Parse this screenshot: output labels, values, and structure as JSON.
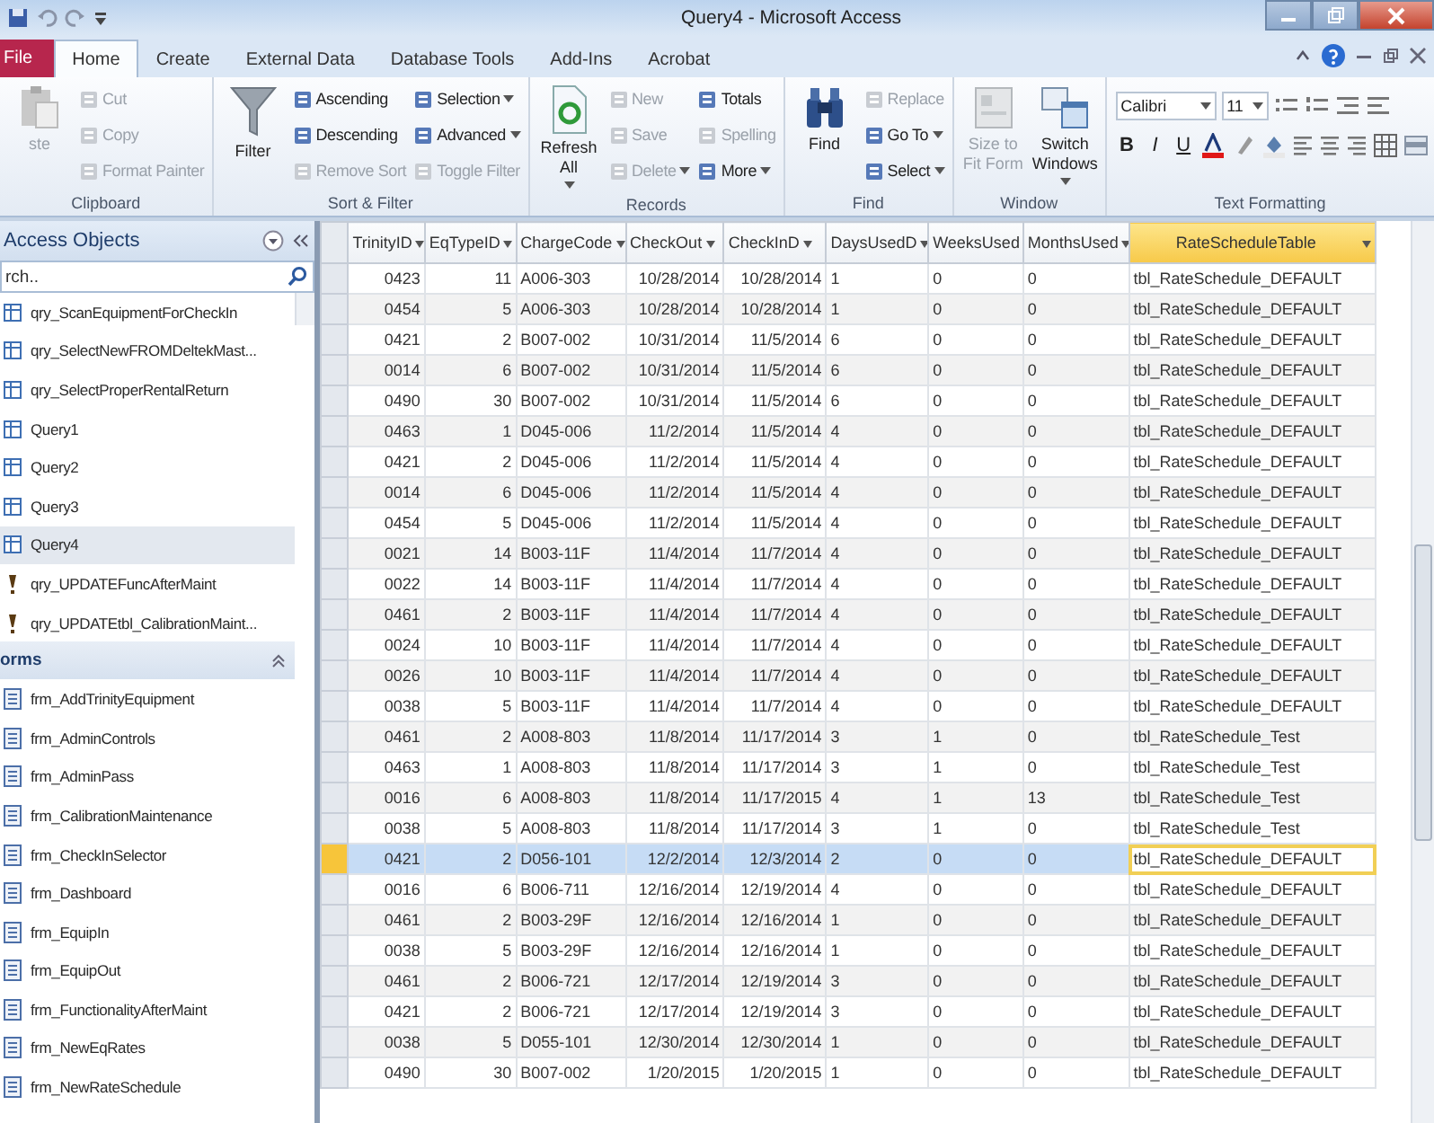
{
  "window": {
    "title": "Query4 - Microsoft Access"
  },
  "ribbon_tabs": [
    {
      "label": "File",
      "kind": "file",
      "selected": false
    },
    {
      "label": "Home",
      "kind": "tab",
      "selected": true
    },
    {
      "label": "Create",
      "kind": "tab",
      "selected": false
    },
    {
      "label": "External Data",
      "kind": "tab",
      "selected": false
    },
    {
      "label": "Database Tools",
      "kind": "tab",
      "selected": false
    },
    {
      "label": "Add-Ins",
      "kind": "tab",
      "selected": false
    },
    {
      "label": "Acrobat",
      "kind": "tab",
      "selected": false
    }
  ],
  "ribbon_groups": [
    {
      "label": "Clipboard",
      "large": [
        {
          "label": "ste",
          "disabled": true,
          "menu": false
        }
      ],
      "columns": [
        [
          {
            "label": "Cut",
            "disabled": true,
            "menu": false
          },
          {
            "label": "Copy",
            "disabled": true,
            "menu": false
          },
          {
            "label": "Format Painter",
            "disabled": true,
            "menu": false
          }
        ]
      ]
    },
    {
      "label": "Sort & Filter",
      "large": [
        {
          "label": "Filter",
          "disabled": false,
          "menu": false
        }
      ],
      "columns": [
        [
          {
            "label": "Ascending",
            "disabled": false,
            "menu": false
          },
          {
            "label": "Descending",
            "disabled": false,
            "menu": false
          },
          {
            "label": "Remove Sort",
            "disabled": true,
            "menu": false
          }
        ],
        [
          {
            "label": "Selection",
            "disabled": false,
            "menu": true
          },
          {
            "label": "Advanced",
            "disabled": false,
            "menu": true
          },
          {
            "label": "Toggle Filter",
            "disabled": true,
            "menu": false
          }
        ]
      ]
    },
    {
      "label": "Records",
      "large": [
        {
          "label": "Refresh All",
          "disabled": false,
          "menu": true
        }
      ],
      "columns": [
        [
          {
            "label": "New",
            "disabled": true,
            "menu": false
          },
          {
            "label": "Save",
            "disabled": true,
            "menu": false
          },
          {
            "label": "Delete",
            "disabled": true,
            "menu": true
          }
        ],
        [
          {
            "label": "Totals",
            "disabled": false,
            "menu": false
          },
          {
            "label": "Spelling",
            "disabled": true,
            "menu": false
          },
          {
            "label": "More",
            "disabled": false,
            "menu": true
          }
        ]
      ]
    },
    {
      "label": "Find",
      "large": [
        {
          "label": "Find",
          "disabled": false,
          "menu": false
        }
      ],
      "columns": [
        [
          {
            "label": "Replace",
            "disabled": true,
            "menu": false
          },
          {
            "label": "Go To",
            "disabled": false,
            "menu": true
          },
          {
            "label": "Select",
            "disabled": false,
            "menu": true
          }
        ]
      ]
    },
    {
      "label": "Window",
      "large": [
        {
          "label": "Size to Fit Form",
          "disabled": true,
          "menu": false
        },
        {
          "label": "Switch Windows",
          "disabled": false,
          "menu": true
        }
      ]
    }
  ],
  "text_formatting": {
    "label": "Text Formatting",
    "font": "Calibri",
    "size": "11",
    "format_buttons": [
      "B",
      "I",
      "U"
    ]
  },
  "nav": {
    "title": "Access Objects",
    "search": {
      "placeholder": "rch.."
    },
    "query_items": [
      {
        "label": "qry_ScanEquipmentForCheckIn",
        "kind": "select",
        "selected": false
      },
      {
        "label": "qry_SelectNewFROMDeltekMast...",
        "kind": "select",
        "selected": false
      },
      {
        "label": "qry_SelectProperRentalReturn",
        "kind": "select",
        "selected": false
      },
      {
        "label": "Query1",
        "kind": "select",
        "selected": false
      },
      {
        "label": "Query2",
        "kind": "select",
        "selected": false
      },
      {
        "label": "Query3",
        "kind": "select",
        "selected": false
      },
      {
        "label": "Query4",
        "kind": "select",
        "selected": true
      },
      {
        "label": "qry_UPDATEFuncAfterMaint",
        "kind": "action",
        "selected": false
      },
      {
        "label": "qry_UPDATEtbl_CalibrationMaint...",
        "kind": "action",
        "selected": false
      }
    ],
    "forms_header": "orms",
    "form_items": [
      "frm_AddTrinityEquipment",
      "frm_AdminControls",
      "frm_AdminPass",
      "frm_CalibrationMaintenance",
      "frm_CheckInSelector",
      "frm_Dashboard",
      "frm_EquipIn",
      "frm_EquipOut",
      "frm_FunctionalityAfterMaint",
      "frm_NewEqRates",
      "frm_NewRateSchedule"
    ]
  },
  "datasheet": {
    "columns": [
      {
        "label": "TrinityID",
        "selected": false
      },
      {
        "label": "EqTypeID",
        "selected": false
      },
      {
        "label": "ChargeCode",
        "selected": false
      },
      {
        "label": "CheckOut",
        "selected": false
      },
      {
        "label": "CheckInD",
        "selected": false
      },
      {
        "label": "DaysUsedD",
        "selected": false
      },
      {
        "label": "WeeksUsed",
        "selected": false
      },
      {
        "label": "MonthsUsed",
        "selected": false
      },
      {
        "label": "RateScheduleTable",
        "selected": true
      }
    ],
    "rows": [
      {
        "selected": false,
        "cells": [
          "0423",
          "11",
          "A006-303",
          "10/28/2014",
          "10/28/2014",
          "1",
          "0",
          "0",
          "tbl_RateSchedule_DEFAULT"
        ]
      },
      {
        "selected": false,
        "cells": [
          "0454",
          "5",
          "A006-303",
          "10/28/2014",
          "10/28/2014",
          "1",
          "0",
          "0",
          "tbl_RateSchedule_DEFAULT"
        ]
      },
      {
        "selected": false,
        "cells": [
          "0421",
          "2",
          "B007-002",
          "10/31/2014",
          "11/5/2014",
          "6",
          "0",
          "0",
          "tbl_RateSchedule_DEFAULT"
        ]
      },
      {
        "selected": false,
        "cells": [
          "0014",
          "6",
          "B007-002",
          "10/31/2014",
          "11/5/2014",
          "6",
          "0",
          "0",
          "tbl_RateSchedule_DEFAULT"
        ]
      },
      {
        "selected": false,
        "cells": [
          "0490",
          "30",
          "B007-002",
          "10/31/2014",
          "11/5/2014",
          "6",
          "0",
          "0",
          "tbl_RateSchedule_DEFAULT"
        ]
      },
      {
        "selected": false,
        "cells": [
          "0463",
          "1",
          "D045-006",
          "11/2/2014",
          "11/5/2014",
          "4",
          "0",
          "0",
          "tbl_RateSchedule_DEFAULT"
        ]
      },
      {
        "selected": false,
        "cells": [
          "0421",
          "2",
          "D045-006",
          "11/2/2014",
          "11/5/2014",
          "4",
          "0",
          "0",
          "tbl_RateSchedule_DEFAULT"
        ]
      },
      {
        "selected": false,
        "cells": [
          "0014",
          "6",
          "D045-006",
          "11/2/2014",
          "11/5/2014",
          "4",
          "0",
          "0",
          "tbl_RateSchedule_DEFAULT"
        ]
      },
      {
        "selected": false,
        "cells": [
          "0454",
          "5",
          "D045-006",
          "11/2/2014",
          "11/5/2014",
          "4",
          "0",
          "0",
          "tbl_RateSchedule_DEFAULT"
        ]
      },
      {
        "selected": false,
        "cells": [
          "0021",
          "14",
          "B003-11F",
          "11/4/2014",
          "11/7/2014",
          "4",
          "0",
          "0",
          "tbl_RateSchedule_DEFAULT"
        ]
      },
      {
        "selected": false,
        "cells": [
          "0022",
          "14",
          "B003-11F",
          "11/4/2014",
          "11/7/2014",
          "4",
          "0",
          "0",
          "tbl_RateSchedule_DEFAULT"
        ]
      },
      {
        "selected": false,
        "cells": [
          "0461",
          "2",
          "B003-11F",
          "11/4/2014",
          "11/7/2014",
          "4",
          "0",
          "0",
          "tbl_RateSchedule_DEFAULT"
        ]
      },
      {
        "selected": false,
        "cells": [
          "0024",
          "10",
          "B003-11F",
          "11/4/2014",
          "11/7/2014",
          "4",
          "0",
          "0",
          "tbl_RateSchedule_DEFAULT"
        ]
      },
      {
        "selected": false,
        "cells": [
          "0026",
          "10",
          "B003-11F",
          "11/4/2014",
          "11/7/2014",
          "4",
          "0",
          "0",
          "tbl_RateSchedule_DEFAULT"
        ]
      },
      {
        "selected": false,
        "cells": [
          "0038",
          "5",
          "B003-11F",
          "11/4/2014",
          "11/7/2014",
          "4",
          "0",
          "0",
          "tbl_RateSchedule_DEFAULT"
        ]
      },
      {
        "selected": false,
        "cells": [
          "0461",
          "2",
          "A008-803",
          "11/8/2014",
          "11/17/2014",
          "3",
          "1",
          "0",
          "tbl_RateSchedule_Test"
        ]
      },
      {
        "selected": false,
        "cells": [
          "0463",
          "1",
          "A008-803",
          "11/8/2014",
          "11/17/2014",
          "3",
          "1",
          "0",
          "tbl_RateSchedule_Test"
        ]
      },
      {
        "selected": false,
        "cells": [
          "0016",
          "6",
          "A008-803",
          "11/8/2014",
          "11/17/2015",
          "4",
          "1",
          "13",
          "tbl_RateSchedule_Test"
        ]
      },
      {
        "selected": false,
        "cells": [
          "0038",
          "5",
          "A008-803",
          "11/8/2014",
          "11/17/2014",
          "3",
          "1",
          "0",
          "tbl_RateSchedule_Test"
        ]
      },
      {
        "selected": true,
        "cells": [
          "0421",
          "2",
          "D056-101",
          "12/2/2014",
          "12/3/2014",
          "2",
          "0",
          "0",
          "tbl_RateSchedule_DEFAULT"
        ]
      },
      {
        "selected": false,
        "cells": [
          "0016",
          "6",
          "B006-711",
          "12/16/2014",
          "12/19/2014",
          "4",
          "0",
          "0",
          "tbl_RateSchedule_DEFAULT"
        ]
      },
      {
        "selected": false,
        "cells": [
          "0461",
          "2",
          "B003-29F",
          "12/16/2014",
          "12/16/2014",
          "1",
          "0",
          "0",
          "tbl_RateSchedule_DEFAULT"
        ]
      },
      {
        "selected": false,
        "cells": [
          "0038",
          "5",
          "B003-29F",
          "12/16/2014",
          "12/16/2014",
          "1",
          "0",
          "0",
          "tbl_RateSchedule_DEFAULT"
        ]
      },
      {
        "selected": false,
        "cells": [
          "0461",
          "2",
          "B006-721",
          "12/17/2014",
          "12/19/2014",
          "3",
          "0",
          "0",
          "tbl_RateSchedule_DEFAULT"
        ]
      },
      {
        "selected": false,
        "cells": [
          "0421",
          "2",
          "B006-721",
          "12/17/2014",
          "12/19/2014",
          "3",
          "0",
          "0",
          "tbl_RateSchedule_DEFAULT"
        ]
      },
      {
        "selected": false,
        "cells": [
          "0038",
          "5",
          "D055-101",
          "12/30/2014",
          "12/30/2014",
          "1",
          "0",
          "0",
          "tbl_RateSchedule_DEFAULT"
        ]
      },
      {
        "selected": false,
        "cells": [
          "0490",
          "30",
          "B007-002",
          "1/20/2015",
          "1/20/2015",
          "1",
          "0",
          "0",
          "tbl_RateSchedule_DEFAULT"
        ]
      }
    ]
  }
}
